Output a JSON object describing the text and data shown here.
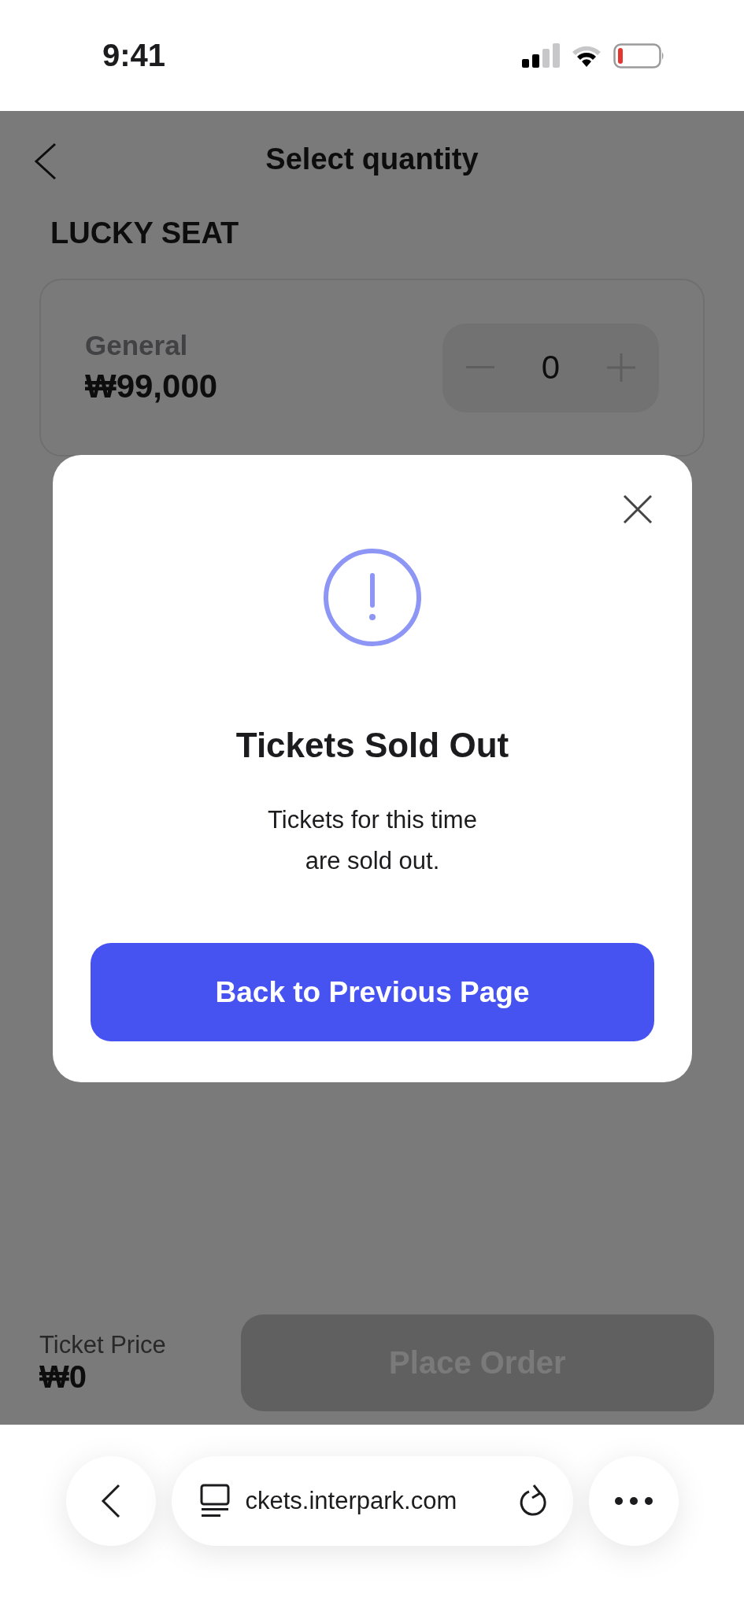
{
  "status_bar": {
    "time": "9:41"
  },
  "header": {
    "title": "Select quantity"
  },
  "section_title": "LUCKY SEAT",
  "tickets": [
    {
      "name": "General",
      "price": "₩99,000",
      "quantity": "0"
    }
  ],
  "footer": {
    "price_label": "Ticket Price",
    "price": "₩0",
    "order_button": {
      "label": "Place Order",
      "disabled": true
    }
  },
  "modal": {
    "title": "Tickets Sold Out",
    "message": "Tickets for this time\nare sold out.",
    "button": "Back to Previous Page"
  },
  "browser": {
    "url": "ckets.interpark.com"
  }
}
